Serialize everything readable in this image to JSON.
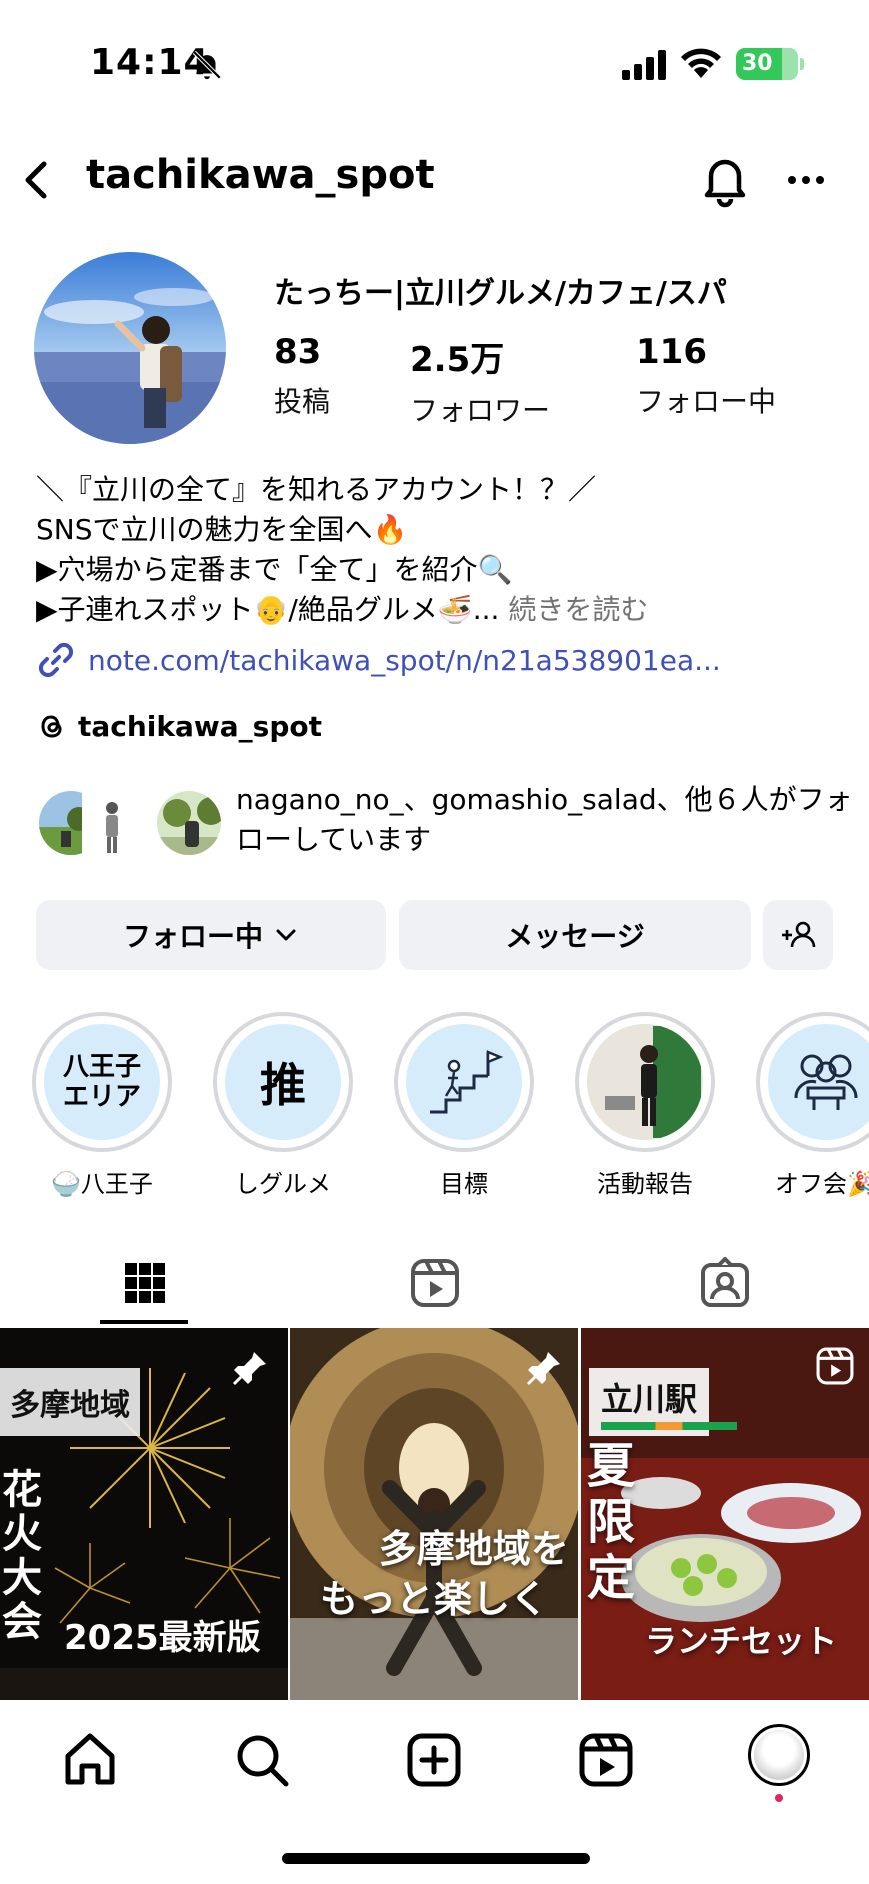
{
  "status_bar": {
    "time": "14:14",
    "battery": "30"
  },
  "header": {
    "username": "tachikawa_spot"
  },
  "profile": {
    "display_name": "たっちー|立川グルメ/カフェ/スパ",
    "stats": [
      {
        "value": "83",
        "label": "投稿"
      },
      {
        "value": "2.5万",
        "label": "フォロワー"
      },
      {
        "value": "116",
        "label": "フォロー中"
      }
    ],
    "bio": [
      "＼『立川の全て』を知れるアカウント！？／",
      "SNSで立川の魅力を全国へ🔥",
      "▶︎穴場から定番まで「全て」を紹介🔍",
      "▶︎子連れスポット👴/絶品グルメ🍜..."
    ],
    "more": "続きを読む",
    "link": "note.com/tachikawa_spot/n/n21a538901ea...",
    "threads": "tachikawa_spot",
    "followed_by": "nagano_no_、gomashio_salad、他６人がフォローしています"
  },
  "buttons": {
    "following": "フォロー中",
    "message": "メッセージ"
  },
  "highlights": [
    {
      "label": "🍚八王子",
      "cover_text": "八王子\nエリア"
    },
    {
      "label": "しグルメ",
      "cover_text": "推"
    },
    {
      "label": "目標",
      "cover_text": ""
    },
    {
      "label": "活動報告",
      "cover_text": ""
    },
    {
      "label": "オフ会🎉",
      "cover_text": ""
    }
  ],
  "posts": [
    {
      "tag": "多摩地域",
      "vertical": "花火大会",
      "caption": "2025最新版"
    },
    {
      "caption": "多摩地域を\nもっと楽しく"
    },
    {
      "tag": "立川駅",
      "vertical": "夏限定",
      "caption": "ランチセット"
    }
  ],
  "colors": {
    "accent": "#3f51b5",
    "button_bg": "#eff1f4",
    "battery": "#34c759",
    "notification_dot": "#e0245e"
  }
}
